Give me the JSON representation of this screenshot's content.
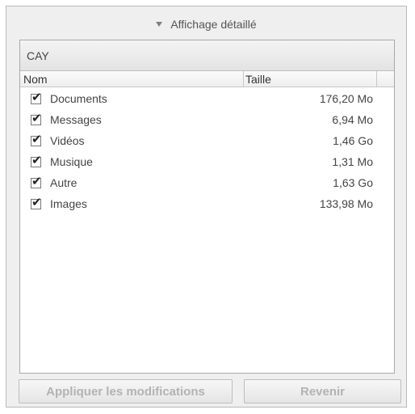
{
  "disclosure": {
    "label": "Affichage détaillé",
    "icon": "triangle-down-icon"
  },
  "device": {
    "name": "CAY"
  },
  "columns": {
    "name": "Nom",
    "size": "Taille"
  },
  "items": [
    {
      "checked": true,
      "name": "Documents",
      "size": "176,20 Mo"
    },
    {
      "checked": true,
      "name": "Messages",
      "size": "6,94 Mo"
    },
    {
      "checked": true,
      "name": "Vidéos",
      "size": "1,46 Go"
    },
    {
      "checked": true,
      "name": "Musique",
      "size": "1,31 Mo"
    },
    {
      "checked": true,
      "name": "Autre",
      "size": "1,63 Go"
    },
    {
      "checked": true,
      "name": "Images",
      "size": "133,98 Mo"
    }
  ],
  "buttons": {
    "apply": "Appliquer les modifications",
    "revert": "Revenir",
    "enabled": false
  },
  "colors": {
    "disabled_text": "#b3b3b3",
    "panel_bg": "#efefef"
  }
}
